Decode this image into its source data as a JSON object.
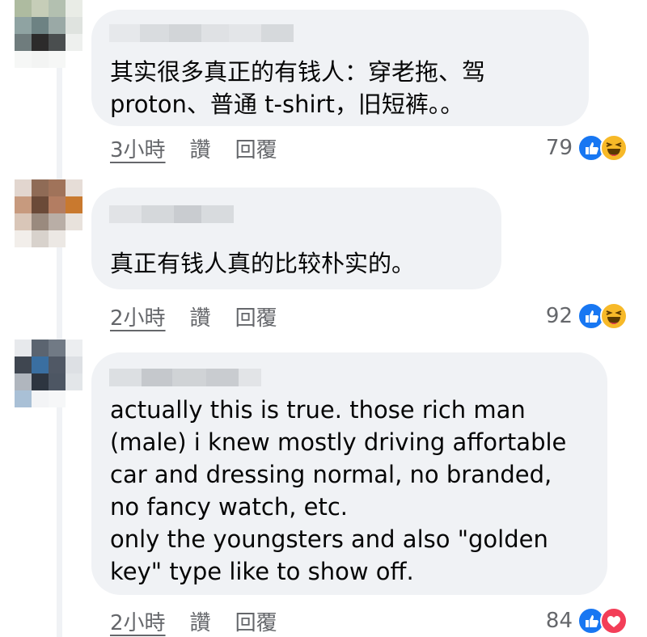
{
  "comments": [
    {
      "text": "其实很多真正的有钱人：穿老拖、驾\nproton、普通 t-shirt，旧短裤。。",
      "time": "3小時",
      "like_label": "讚",
      "reply_label": "回覆",
      "reaction_count": "79",
      "reactions": [
        "like-icon",
        "haha-icon"
      ]
    },
    {
      "text": "真正有钱人真的比较朴实的。",
      "time": "2小時",
      "like_label": "讚",
      "reply_label": "回覆",
      "reaction_count": "92",
      "reactions": [
        "like-icon",
        "haha-icon"
      ]
    },
    {
      "text": "actually this is true. those rich man\n(male) i knew mostly driving affortable\ncar and dressing normal, no branded,\nno fancy watch, etc.\nonly the youngsters and also \"golden\nkey\" type like to show off.",
      "time": "2小時",
      "like_label": "讚",
      "reply_label": "回覆",
      "reaction_count": "84",
      "reactions": [
        "like-icon",
        "love-icon"
      ]
    }
  ],
  "colors": {
    "bubble": "#f0f2f5",
    "text": "#050505",
    "meta": "#65676b",
    "like": "#1877f2",
    "haha": "#f7b928",
    "love": "#f33e58"
  }
}
